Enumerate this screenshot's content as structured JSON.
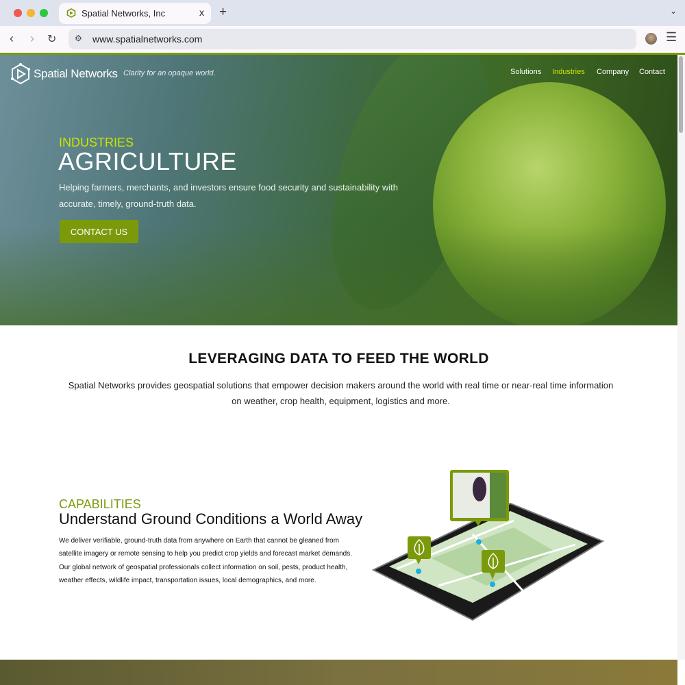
{
  "browser": {
    "tab_title": "Spatial Networks, Inc",
    "url": "www.spatialnetworks.com",
    "new_tab": "+",
    "close": "x"
  },
  "header": {
    "brand": "Spatial Networks",
    "tagline": "Clarity for an opaque world.",
    "nav": [
      {
        "label": "Solutions"
      },
      {
        "label": "Industries",
        "active": true
      },
      {
        "label": "Company"
      },
      {
        "label": "Contact"
      }
    ]
  },
  "hero": {
    "eyebrow": "INDUSTRIES",
    "title": "AGRICULTURE",
    "text": "Helping farmers, merchants, and investors ensure food security and sustainability with accurate, timely, ground-truth data.",
    "cta": "CONTACT US"
  },
  "intro": {
    "title": "LEVERAGING DATA TO FEED THE WORLD",
    "text": "Spatial Networks provides geospatial solutions that empower decision makers around the world with real time or near-real time information on weather, crop health, equipment, logistics and more."
  },
  "capabilities": {
    "eyebrow": "CAPABILITIES",
    "title": "Understand Ground Conditions a World Away",
    "text": "We deliver verifiable, ground-truth data from anywhere on Earth that cannot be gleaned from satellite imagery or remote sensing to help you predict crop yields and forecast market demands. Our global network of geospatial professionals collect information on soil, pests, product health, weather effects, wildlife impact, transportation issues, local demographics, and more."
  },
  "colors": {
    "accent": "#7a9a0c",
    "highlight": "#c8e600"
  }
}
